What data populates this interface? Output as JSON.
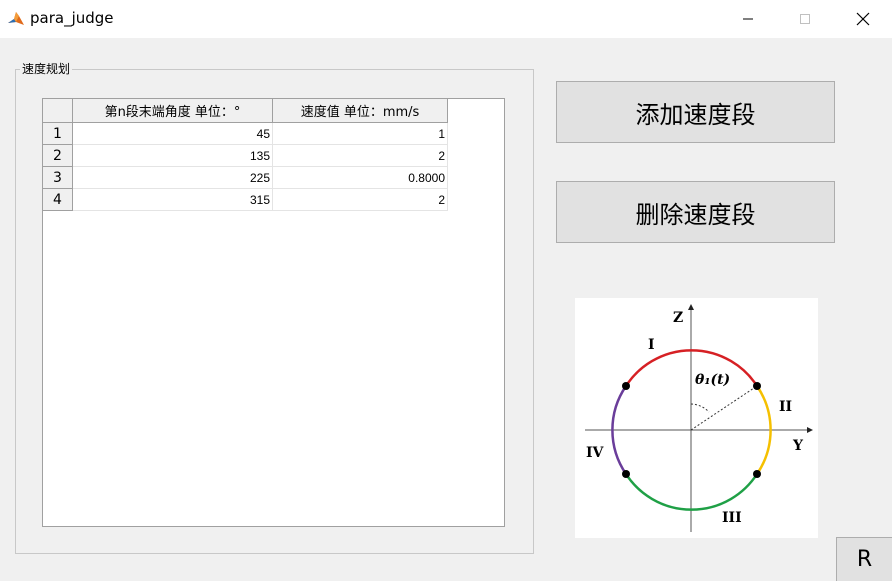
{
  "window": {
    "title": "para_judge",
    "icon": "matlab-icon",
    "controls": {
      "minimize": "minimize-icon",
      "maximize": "maximize-icon",
      "close": "close-icon"
    }
  },
  "panel": {
    "title": "速度规划",
    "table": {
      "headers": [
        "第n段末端角度 单位：°",
        "速度值 单位：mm/s"
      ],
      "rows": [
        {
          "index": "1",
          "angle": "45",
          "speed": "1"
        },
        {
          "index": "2",
          "angle": "135",
          "speed": "2"
        },
        {
          "index": "3",
          "angle": "225",
          "speed": "0.8000"
        },
        {
          "index": "4",
          "angle": "315",
          "speed": "2"
        }
      ]
    }
  },
  "buttons": {
    "add": "添加速度段",
    "delete": "删除速度段",
    "r": "R"
  },
  "diagram": {
    "axis_z": "Z",
    "axis_y": "Y",
    "theta_label": "θ₁(t)",
    "quadrants": [
      "I",
      "II",
      "III",
      "IV"
    ],
    "colors": {
      "I": "#d62024",
      "II": "#f5c000",
      "III": "#1fa046",
      "IV": "#6a3d9a"
    }
  }
}
